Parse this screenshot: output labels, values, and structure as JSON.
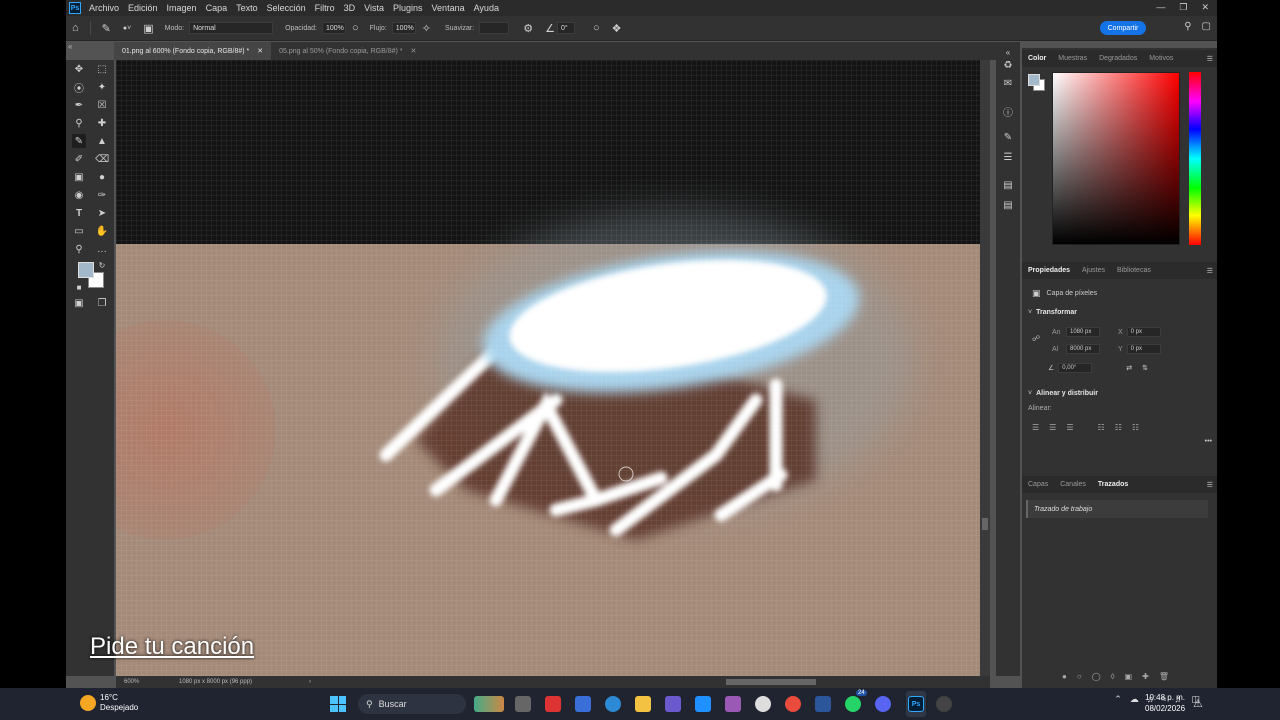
{
  "app": {
    "menu": [
      "Archivo",
      "Edición",
      "Imagen",
      "Capa",
      "Texto",
      "Selección",
      "Filtro",
      "3D",
      "Vista",
      "Plugins",
      "Ventana",
      "Ayuda"
    ]
  },
  "options": {
    "mode_label": "Modo:",
    "mode_value": "Normal",
    "opacity_label": "Opacidad:",
    "opacity_value": "100%",
    "flow_label": "Flujo:",
    "flow_value": "100%",
    "smooth_label": "Suavizar:",
    "angle_value": "0°",
    "share_label": "Compartir"
  },
  "tabs": [
    {
      "label": "01.png al 600% (Fondo copia, RGB/8#) *"
    },
    {
      "label": "05.png al 50% (Fondo copia, RGB/8#) *"
    }
  ],
  "canvas": {
    "overlay_text": "Pide tu canción"
  },
  "status": {
    "zoom": "600%",
    "dims": "1080 px x 8000 px (96 ppp)"
  },
  "color_panel": {
    "tabs": [
      "Color",
      "Muestras",
      "Degradados",
      "Motivos"
    ]
  },
  "properties_panel": {
    "tabs": [
      "Propiedades",
      "Ajustes",
      "Bibliotecas"
    ],
    "layer_type": "Capa de píxeles",
    "transform_title": "Transformar",
    "w_label": "An",
    "w_value": "1080 px",
    "h_label": "Al",
    "h_value": "8000 px",
    "x_label": "X",
    "x_value": "0 px",
    "y_label": "Y",
    "y_value": "0 px",
    "angle_value": "0,00°",
    "align_title": "Alinear y distribuir",
    "align_label": "Alinear:",
    "more": "•••"
  },
  "layers_panel": {
    "tabs": [
      "Capas",
      "Canales",
      "Trazados"
    ],
    "path_item": "Trazado de trabajo"
  },
  "taskbar": {
    "temp": "16°C",
    "weather": "Despejado",
    "search": "Buscar",
    "time": "10:48 p. m.",
    "date": "08/02/2026",
    "badge_24": "24"
  }
}
